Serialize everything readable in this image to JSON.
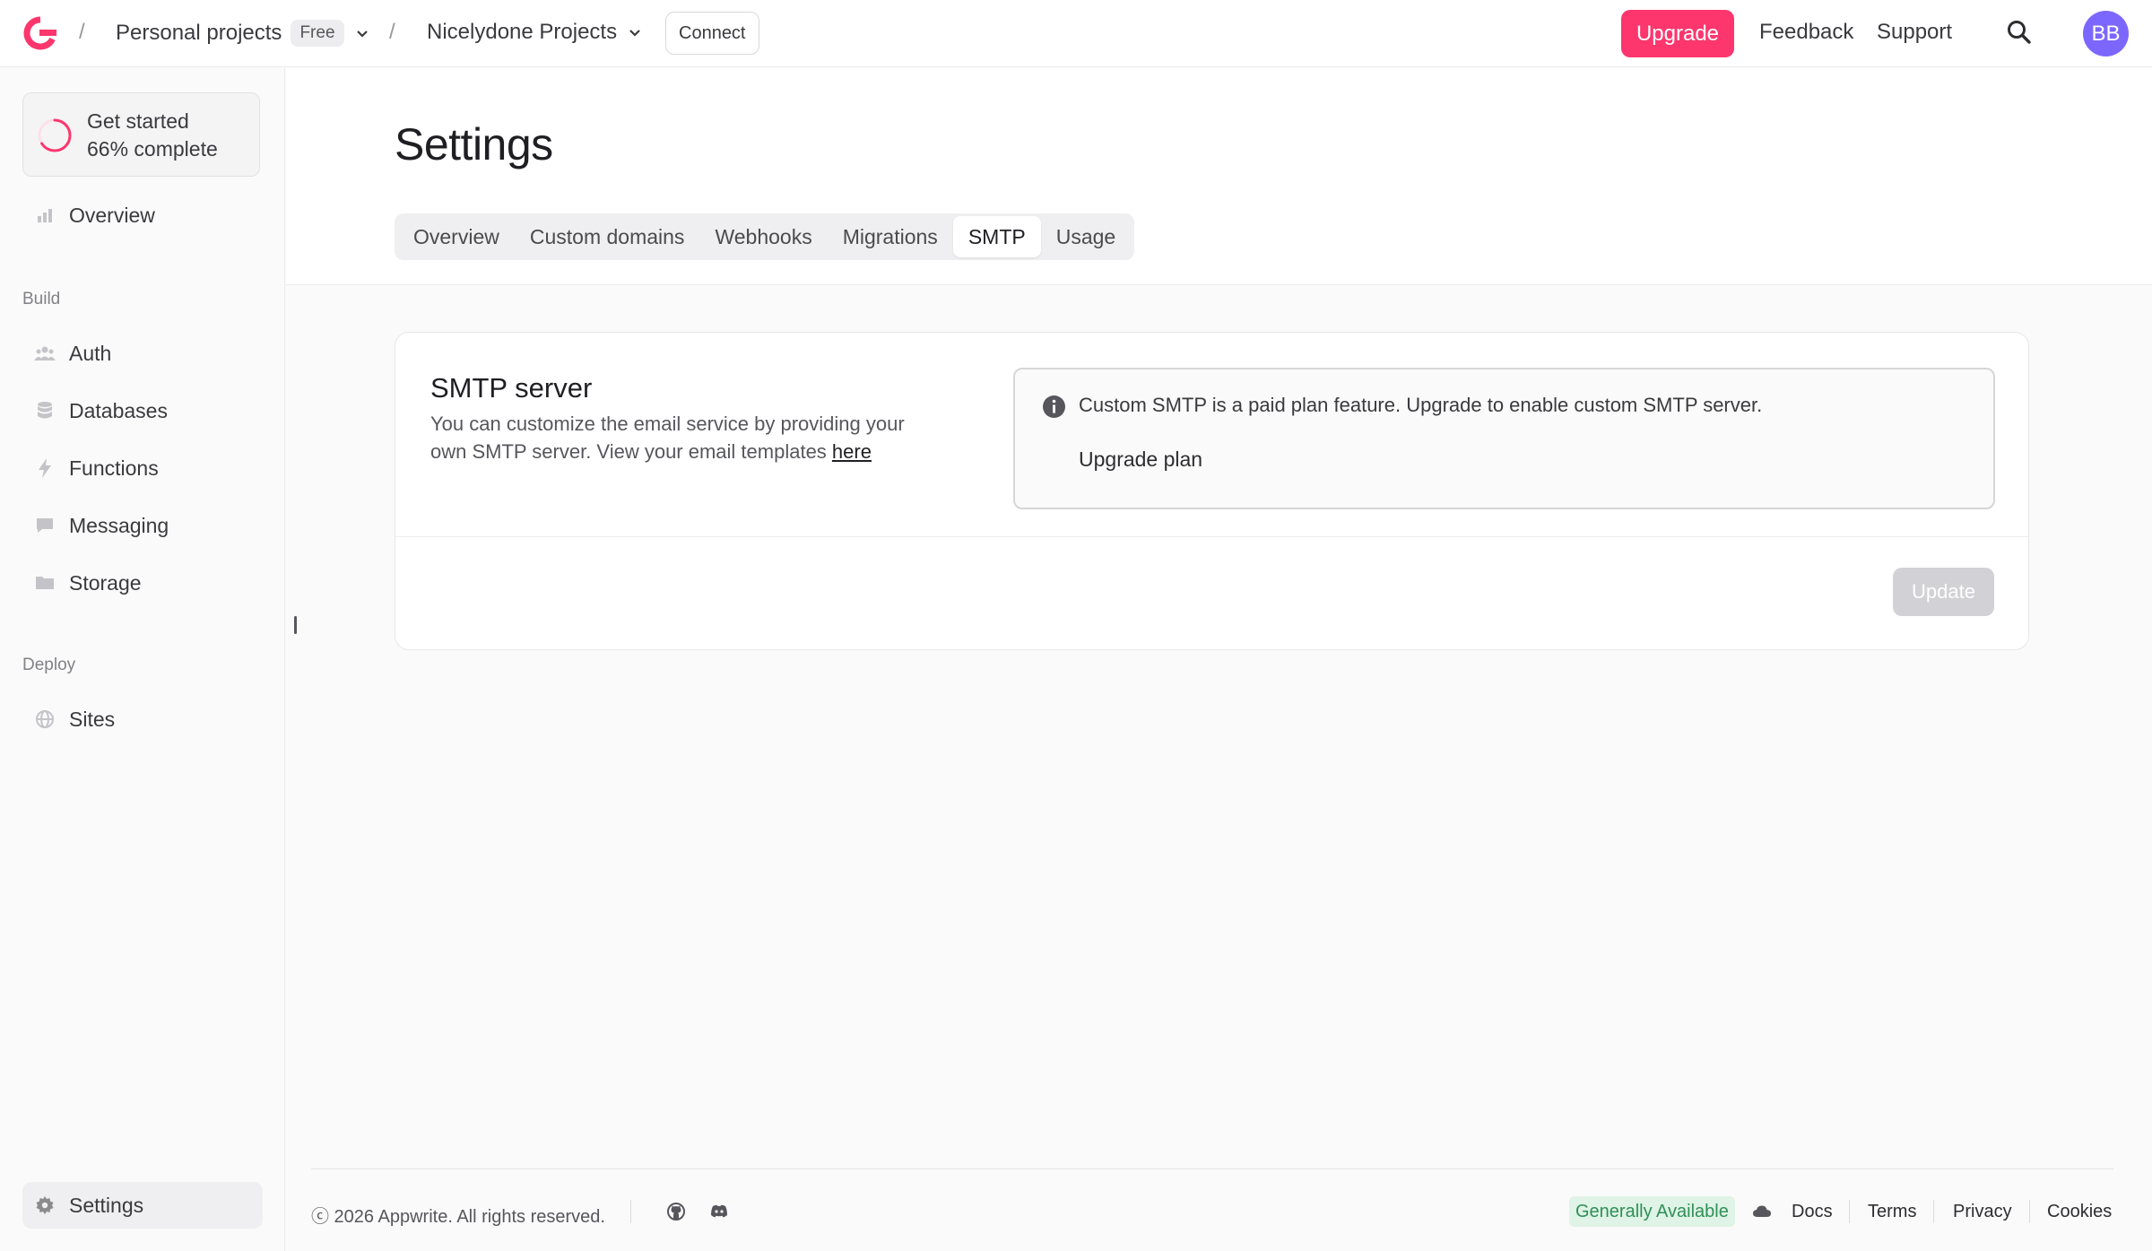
{
  "topbar": {
    "org_name": "Personal projects",
    "plan_badge": "Free",
    "project_name": "Nicelydone Projects",
    "connect_label": "Connect",
    "upgrade_label": "Upgrade",
    "feedback_label": "Feedback",
    "support_label": "Support",
    "avatar_initials": "BB"
  },
  "sidebar": {
    "get_started": {
      "title": "Get started",
      "progress_text": "66% complete",
      "progress": 0.66
    },
    "overview_label": "Overview",
    "build_section": "Build",
    "build_items": [
      {
        "label": "Auth",
        "icon": "users-icon"
      },
      {
        "label": "Databases",
        "icon": "database-icon"
      },
      {
        "label": "Functions",
        "icon": "lightning-icon"
      },
      {
        "label": "Messaging",
        "icon": "chat-icon"
      },
      {
        "label": "Storage",
        "icon": "folder-icon"
      }
    ],
    "deploy_section": "Deploy",
    "deploy_items": [
      {
        "label": "Sites",
        "icon": "globe-icon"
      }
    ],
    "settings_label": "Settings"
  },
  "main": {
    "title": "Settings",
    "tabs": [
      {
        "label": "Overview",
        "active": false
      },
      {
        "label": "Custom domains",
        "active": false
      },
      {
        "label": "Webhooks",
        "active": false
      },
      {
        "label": "Migrations",
        "active": false
      },
      {
        "label": "SMTP",
        "active": true
      },
      {
        "label": "Usage",
        "active": false
      }
    ],
    "card": {
      "title": "SMTP server",
      "description": "You can customize the email service by providing your own SMTP server. View your email templates ",
      "description_link": "here",
      "alert_text": "Custom SMTP is a paid plan feature. Upgrade to enable custom SMTP server.",
      "alert_link": "Upgrade plan",
      "update_label": "Update"
    }
  },
  "footer": {
    "copyright": "ⓒ 2026 Appwrite. All rights reserved.",
    "status_badge": "Generally Available",
    "links": [
      "Docs",
      "Terms",
      "Privacy",
      "Cookies"
    ]
  },
  "colors": {
    "brand": "#fd366e",
    "avatar": "#7c67fe",
    "status_green": "#2f8f57"
  }
}
